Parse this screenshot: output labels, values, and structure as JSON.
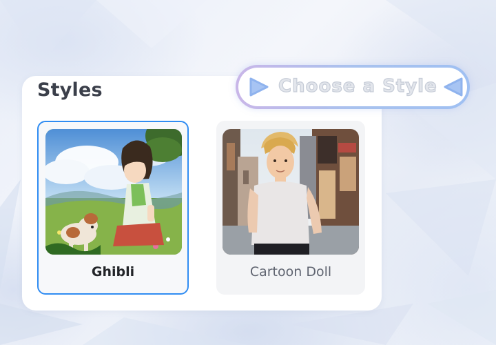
{
  "panel": {
    "title": "Styles"
  },
  "banner": {
    "label": "Choose a Style",
    "left_icon": "play-right-icon",
    "right_icon": "play-left-icon"
  },
  "styles": [
    {
      "label": "Ghibli",
      "selected": true,
      "thumbnail": "anime-girl-with-dog-in-meadow"
    },
    {
      "label": "Cartoon Doll",
      "selected": false,
      "thumbnail": "cartoon-man-on-city-street"
    }
  ],
  "colors": {
    "selection_border": "#2f8cf2",
    "title_text": "#3b3f4a",
    "banner_gradient_start": "#c9b6e8",
    "banner_gradient_end": "#9fc0f2",
    "arrow_fill": "#a7c4f3"
  }
}
